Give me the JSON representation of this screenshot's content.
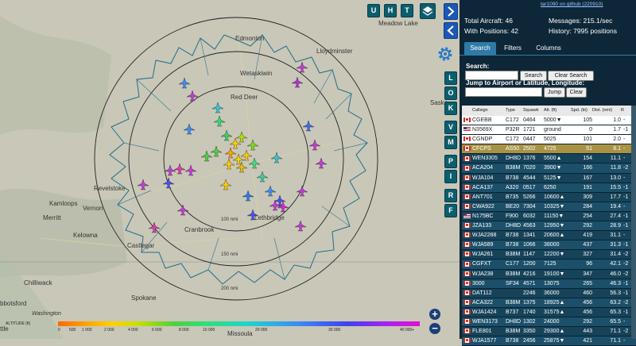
{
  "map": {
    "cities": [
      "Edmonton",
      "Meadow Lake",
      "Lloydminster",
      "Wetaskiwin",
      "Red Deer",
      "Revelstoke",
      "Kamloops",
      "Vernon",
      "Kelowna",
      "Merritt",
      "Castlegar",
      "Cranbrook",
      "Lethbridge",
      "Chilliwack",
      "Spokane",
      "Washington",
      "Missoula",
      "Saska",
      "bbotsford",
      "ttle"
    ],
    "range_labels": [
      "100 nmi",
      "150 nmi",
      "200 nmi"
    ],
    "buttons": {
      "u": "U",
      "h": "H",
      "t": "T",
      "l": "L",
      "o": "O",
      "k": "K",
      "v": "V",
      "m": "M",
      "p": "P",
      "i": "I",
      "r": "R",
      "f": "F"
    },
    "zoom_in": "+",
    "zoom_out": "−"
  },
  "legend": {
    "title": "ALTITUDE (ft)",
    "ticks": [
      "0",
      "500",
      "1 000",
      "2 000",
      "4 000",
      "6 000",
      "8 000",
      "10 000",
      "20 000",
      "30 000",
      "40 000+"
    ]
  },
  "stats": {
    "total_aircraft": "Total Aircraft: 46",
    "with_positions": "With Positions: 42",
    "messages": "Messages: 215.1/sec",
    "history": "History: 7995 positions",
    "github_link": "tar1090 on github (220910)"
  },
  "tabs": [
    "Search",
    "Filters",
    "Columns"
  ],
  "search": {
    "label": "Search:",
    "search_button": "Search",
    "clear_button": "Clear Search",
    "jump_label": "Jump to Airport or Latitude, Longitude:",
    "jump_button": "Jump",
    "clear_jump_button": "Clear"
  },
  "table": {
    "columns": [
      "Callsign",
      "Type",
      "Squawk",
      "Alt. (ft)",
      "Spd. (kt)",
      "Dist. (nmi)",
      "R"
    ],
    "rows": [
      {
        "flag": "ca",
        "callsign": "CGEBB",
        "type": "C172",
        "squawk": "0464",
        "alt": "5000▼",
        "spd": "105",
        "dist": "1.0",
        "r": "-",
        "style": "plain"
      },
      {
        "flag": "us",
        "callsign": "N3569X",
        "type": "P32R",
        "squawk": "1721",
        "alt": "ground",
        "spd": "0",
        "dist": "1.7",
        "r": "-1",
        "style": "plain"
      },
      {
        "flag": "ca",
        "callsign": "CGNDP",
        "type": "C172",
        "squawk": "0447",
        "alt": "5025",
        "spd": "101",
        "dist": "2.0",
        "r": "-",
        "style": "plain"
      },
      {
        "flag": "ca",
        "callsign": "CFCPS",
        "type": "AS50",
        "squawk": "2502",
        "alt": "4725",
        "spd": "51",
        "dist": "8.1",
        "r": "-",
        "style": "sel"
      },
      {
        "flag": "ca",
        "callsign": "WEN3305",
        "type": "DH8D",
        "squawk": "1376",
        "alt": "5500▲",
        "spd": "154",
        "dist": "11.1",
        "r": "-",
        "style": ""
      },
      {
        "flag": "ca",
        "callsign": "ACA204",
        "type": "B38M",
        "squawk": "7020",
        "alt": "3900▼",
        "spd": "166",
        "dist": "11.8",
        "r": "-2",
        "style": ""
      },
      {
        "flag": "ca",
        "callsign": "WJA104",
        "type": "B738",
        "squawk": "4544",
        "alt": "5125▼",
        "spd": "167",
        "dist": "13.0",
        "r": "-",
        "style": ""
      },
      {
        "flag": "ca",
        "callsign": "ACA137",
        "type": "A320",
        "squawk": "0517",
        "alt": "6250",
        "spd": "191",
        "dist": "15.5",
        "r": "-1",
        "style": ""
      },
      {
        "flag": "ca",
        "callsign": "ANT701",
        "type": "B735",
        "squawk": "5266",
        "alt": "10600▲",
        "spd": "309",
        "dist": "17.7",
        "r": "-1",
        "style": ""
      },
      {
        "flag": "ca",
        "callsign": "CWA922",
        "type": "BE20",
        "squawk": "7304",
        "alt": "10325▼",
        "spd": "284",
        "dist": "19.4",
        "r": "-",
        "style": ""
      },
      {
        "flag": "us",
        "callsign": "N175BC",
        "type": "F900",
        "squawk": "6032",
        "alt": "11150▼",
        "spd": "254",
        "dist": "27.4",
        "r": "-1",
        "style": ""
      },
      {
        "flag": "ca",
        "callsign": "JZA133",
        "type": "DH8D",
        "squawk": "4563",
        "alt": "12950▼",
        "spd": "292",
        "dist": "28.9",
        "r": "-1",
        "style": ""
      },
      {
        "flag": "ca",
        "callsign": "WJA2288",
        "type": "B738",
        "squawk": "1341",
        "alt": "20600▲",
        "spd": "419",
        "dist": "31.1",
        "r": "-",
        "style": ""
      },
      {
        "flag": "ca",
        "callsign": "WJA589",
        "type": "B738",
        "squawk": "1066",
        "alt": "38000",
        "spd": "437",
        "dist": "31.3",
        "r": "-1",
        "style": ""
      },
      {
        "flag": "ca",
        "callsign": "WJA261",
        "type": "B38M",
        "squawk": "1147",
        "alt": "12200▼",
        "spd": "327",
        "dist": "31.4",
        "r": "-2",
        "style": ""
      },
      {
        "flag": "ca",
        "callsign": "CGFXT",
        "type": "C177",
        "squawk": "1200",
        "alt": "7125",
        "spd": "96",
        "dist": "42.1",
        "r": "-2",
        "style": ""
      },
      {
        "flag": "ca",
        "callsign": "WJA238",
        "type": "B38M",
        "squawk": "4216",
        "alt": "19100▼",
        "spd": "347",
        "dist": "46.0",
        "r": "-2",
        "style": ""
      },
      {
        "flag": "ca",
        "callsign": "3000",
        "type": "SF34",
        "squawk": "4571",
        "alt": "13075",
        "spd": "265",
        "dist": "46.3",
        "r": "-1",
        "style": ""
      },
      {
        "flag": "ca",
        "callsign": "DAT112",
        "type": "",
        "squawk": "2246",
        "alt": "36000",
        "spd": "460",
        "dist": "56.3",
        "r": "-1",
        "style": ""
      },
      {
        "flag": "ca",
        "callsign": "ACA322",
        "type": "B38M",
        "squawk": "1375",
        "alt": "18925▲",
        "spd": "456",
        "dist": "63.2",
        "r": "-2",
        "style": ""
      },
      {
        "flag": "ca",
        "callsign": "WJA1424",
        "type": "B737",
        "squawk": "1740",
        "alt": "31575▲",
        "spd": "456",
        "dist": "65.3",
        "r": "-1",
        "style": ""
      },
      {
        "flag": "ca",
        "callsign": "WEN3173",
        "type": "DH8D",
        "squawk": "1302",
        "alt": "24000",
        "spd": "292",
        "dist": "65.5",
        "r": "-",
        "style": ""
      },
      {
        "flag": "ca",
        "callsign": "FLE801",
        "type": "B38M",
        "squawk": "3350",
        "alt": "29300▲",
        "spd": "443",
        "dist": "71.1",
        "r": "-2",
        "style": ""
      },
      {
        "flag": "ca",
        "callsign": "WJA1577",
        "type": "B738",
        "squawk": "2456",
        "alt": "25875▼",
        "spd": "421",
        "dist": "71.1",
        "r": "-",
        "style": ""
      }
    ]
  },
  "colors": {
    "panel_bg": "#0d2738",
    "row_odd": "#16435a",
    "row_even": "#1c506a",
    "row_selected": "#a89344",
    "accent": "#0b5e6e"
  }
}
